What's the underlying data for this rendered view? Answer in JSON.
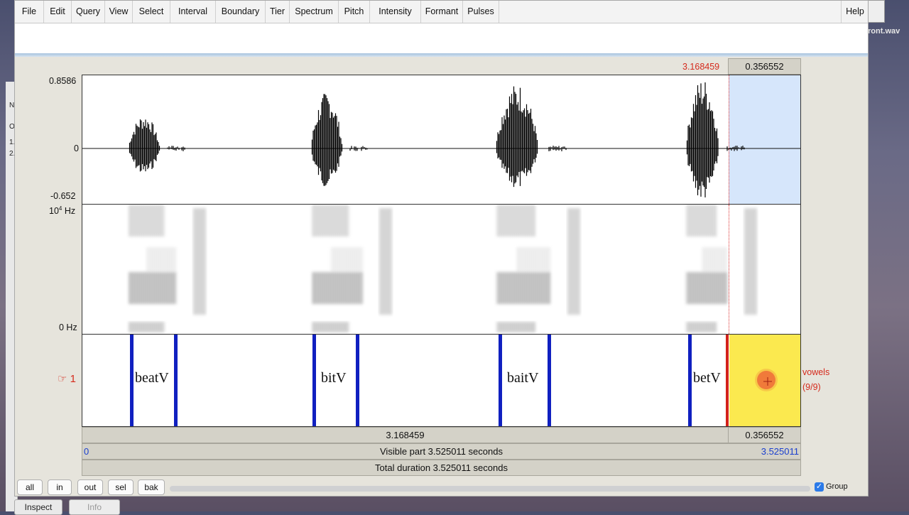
{
  "menu": [
    "File",
    "Edit",
    "Query",
    "View",
    "Select",
    "Interval",
    "Boundary",
    "Tier",
    "Spectrum",
    "Pitch",
    "Intensity",
    "Formant",
    "Pulses"
  ],
  "help": "Help",
  "background_filename": "ront.wav",
  "top_readout": {
    "cursor_time": "3.168459",
    "selection_duration": "0.356552"
  },
  "waveform": {
    "max": "0.8586",
    "zero": "0",
    "min": "-0.652"
  },
  "spectrogram": {
    "top_label_base": "10",
    "top_label_exp": "4",
    "top_label_unit": "Hz",
    "bottom_label": "0 Hz"
  },
  "tier": {
    "pointer": "☞",
    "number": "1",
    "name": "vowels",
    "count": "(9/9)",
    "intervals": [
      {
        "label": "beatV"
      },
      {
        "label": "bitV"
      },
      {
        "label": "baitV"
      },
      {
        "label": "betV"
      }
    ]
  },
  "bars": {
    "left_duration": "3.168459",
    "right_duration": "0.356552",
    "visible_start": "0",
    "visible_label": "Visible part 3.525011 seconds",
    "visible_end": "3.525011",
    "total_label": "Total duration 3.525011 seconds"
  },
  "buttons": [
    "all",
    "in",
    "out",
    "sel",
    "bak"
  ],
  "group_label": "Group",
  "bottom_tabs": [
    "Inspect",
    "Info"
  ],
  "back_window_letters": [
    "N",
    "O",
    "1.",
    "2."
  ]
}
